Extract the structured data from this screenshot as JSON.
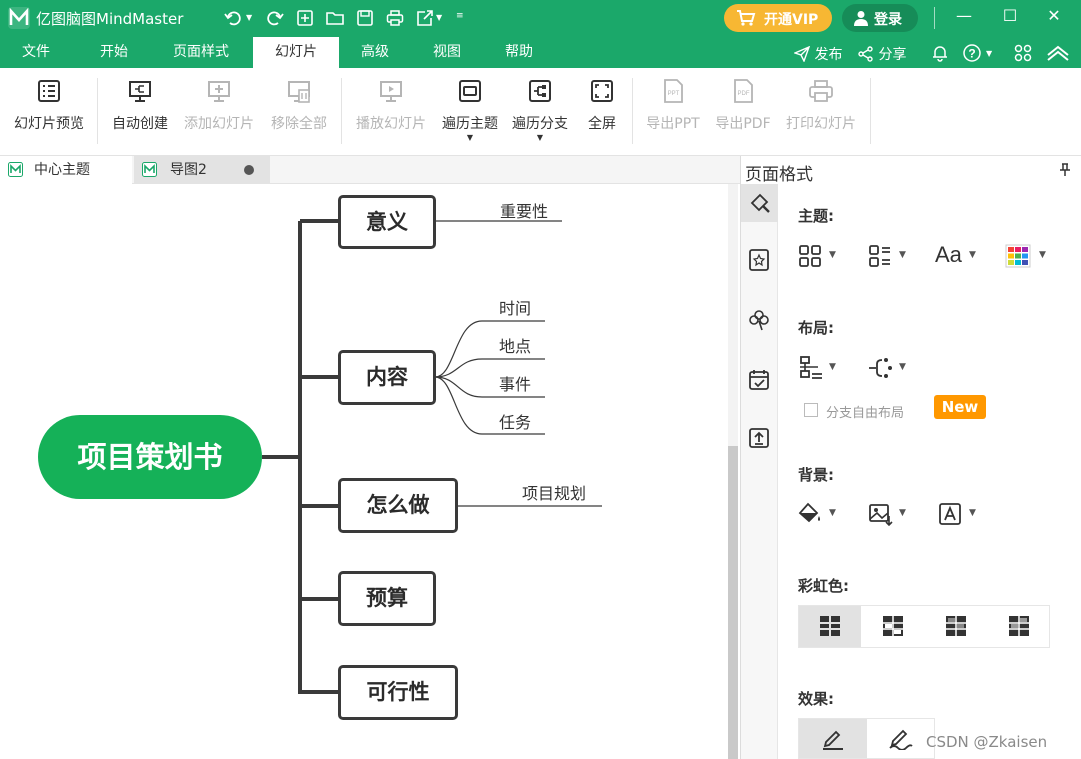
{
  "app": {
    "title": "亿图脑图MindMaster",
    "vip_label": "开通VIP",
    "login_label": "登录",
    "brand_color": "#1ba86a"
  },
  "menu": {
    "tabs": [
      "文件",
      "开始",
      "页面样式",
      "幻灯片",
      "高级",
      "视图",
      "帮助"
    ],
    "active": "幻灯片",
    "publish": "发布",
    "share": "分享"
  },
  "ribbon": {
    "slide_preview": "幻灯片预览",
    "auto_create": "自动创建",
    "add_slide": "添加幻灯片",
    "remove_all": "移除全部",
    "play_slides": "播放幻灯片",
    "traverse_topic": "遍历主题",
    "traverse_branch": "遍历分支",
    "fullscreen": "全屏",
    "export_ppt": "导出PPT",
    "export_pdf": "导出PDF",
    "print_slides": "打印幻灯片"
  },
  "doc_tabs": [
    {
      "label": "中心主题"
    },
    {
      "label": "导图2"
    }
  ],
  "mindmap": {
    "central": "项目策划书",
    "central_color": "#15b158",
    "branches": [
      {
        "label": "意义",
        "subtopics": [
          "重要性"
        ]
      },
      {
        "label": "内容",
        "subtopics": [
          "时间",
          "地点",
          "事件",
          "任务"
        ]
      },
      {
        "label": "怎么做",
        "subtopics": [
          "项目规划"
        ]
      },
      {
        "label": "预算",
        "subtopics": []
      },
      {
        "label": "可行性",
        "subtopics": []
      }
    ]
  },
  "panel": {
    "title": "页面格式",
    "theme_label": "主题:",
    "layout_label": "布局:",
    "free_layout_label": "分支自由布局",
    "new_badge": "New",
    "background_label": "背景:",
    "rainbow_label": "彩虹色:",
    "effect_label": "效果:"
  },
  "watermark": "CSDN @Zkaisen"
}
